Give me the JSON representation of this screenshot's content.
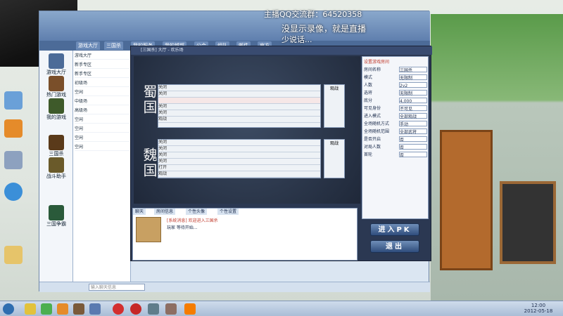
{
  "overlay": {
    "watermark_text": "主播QQ交流群：64520358",
    "recording_notice": "没显示录像，就是直播",
    "recording_notice2": "少说话..."
  },
  "hall": {
    "nav_tabs": [
      "游戏大厅",
      "三国杀",
      "我的服务",
      "我的城邦",
      "公会",
      "组队",
      "邮件",
      "官方"
    ],
    "side_items": [
      "游戏大厅",
      "热门游戏",
      "我的游戏",
      "三国杀",
      "战斗助手",
      "三国争霸"
    ],
    "rooms": [
      "游戏大厅",
      "新手专区",
      "新手专区",
      "初级场",
      "空闲",
      "中级场",
      "高级场",
      "空闲",
      "空闲",
      "空闲",
      "空闲"
    ],
    "chat_placeholder": "输入聊天信息"
  },
  "game": {
    "title": "[三国杀] 大厅 - 欢乐场",
    "factions": [
      "蜀国",
      "魏国"
    ],
    "top_team_rows": [
      "关闭",
      "关闭",
      "",
      "关闭",
      "关闭",
      "观战"
    ],
    "bottom_team_rows": [
      "关闭",
      "关闭",
      "关闭",
      "关闭",
      "打开",
      "观战"
    ],
    "side_label_top": "观战",
    "side_label_bottom": "观战",
    "settings_title": "设置游戏房间",
    "settings_rows": [
      {
        "label": "房间名称",
        "value": "三国杀"
      },
      {
        "label": "模式",
        "value": "无限制"
      },
      {
        "label": "人数",
        "value": "2v2"
      },
      {
        "label": "选将",
        "value": "无限制"
      },
      {
        "label": "底分",
        "value": "4,000"
      },
      {
        "label": "可见身份",
        "value": "不可见"
      },
      {
        "label": "进入模式",
        "value": "全部观战"
      },
      {
        "label": "全场随机方式",
        "value": "手动"
      },
      {
        "label": "全场随机范围",
        "value": "全部武将"
      },
      {
        "label": "是否开启",
        "value": "否"
      },
      {
        "label": "对局人数",
        "value": "否"
      },
      {
        "label": "首轮",
        "value": "否"
      }
    ],
    "start_button": "进入PK",
    "exit_button": "退出",
    "chat_tabs": [
      "聊天",
      "房间信息",
      "个性头像",
      "个性设置"
    ],
    "chat_lines": [
      "[系统消息] 欢迎进入三国杀",
      "玩家 等待开始..."
    ]
  },
  "taskbar": {
    "clock_time": "12:00",
    "clock_date": "2012-05-18"
  }
}
